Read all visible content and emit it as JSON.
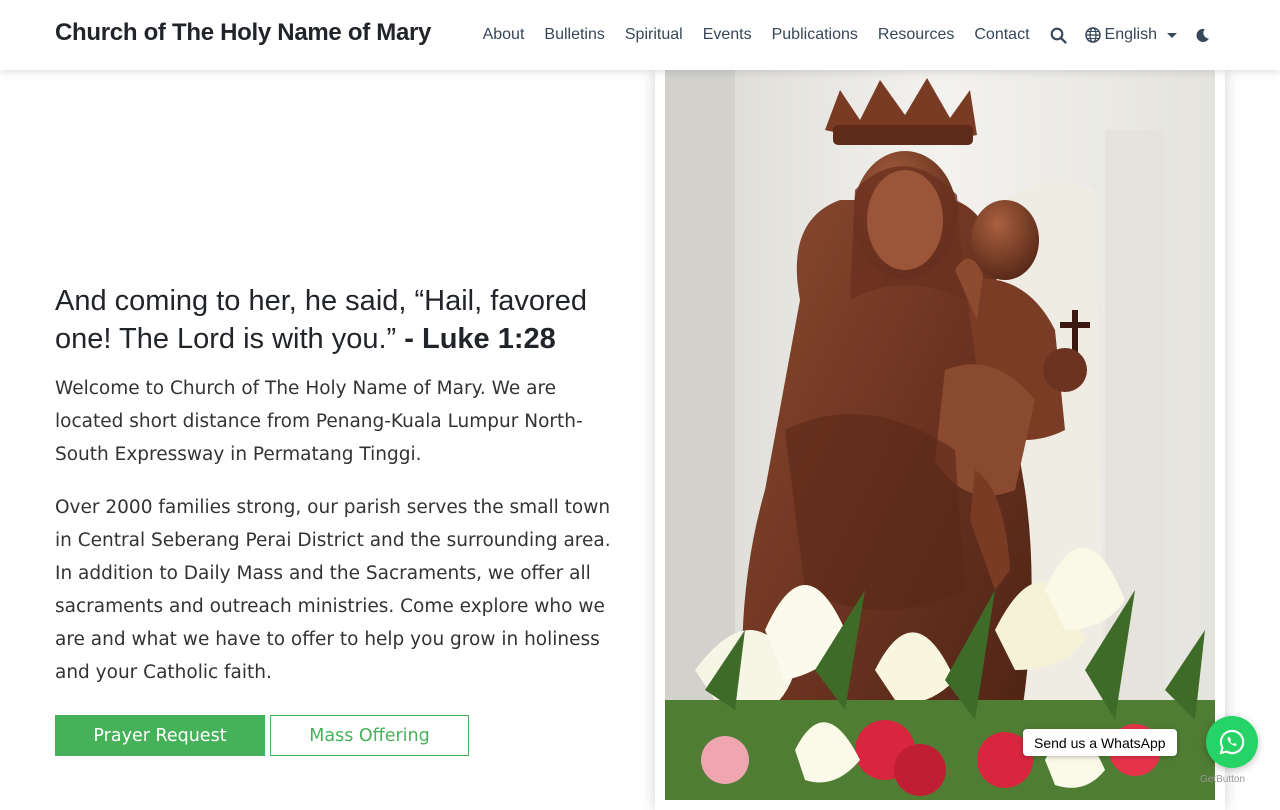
{
  "header": {
    "brand": "Church of The Holy Name of Mary",
    "nav": [
      "About",
      "Bulletins",
      "Spiritual",
      "Events",
      "Publications",
      "Resources",
      "Contact"
    ],
    "language": "English",
    "icons": {
      "search": "search-icon",
      "globe": "globe-icon",
      "theme": "moon-icon"
    }
  },
  "hero": {
    "quote": "And coming to her, he said, “Hail, favored one! The Lord is with you.”",
    "quote_ref": "- Luke 1:28",
    "intro_prefix": "Welcome to ",
    "intro_name": "Church of The Holy Name of Mary",
    "intro_suffix": ". We are located short distance from Penang-Kuala Lumpur North-South Expressway in Permatang Tinggi.",
    "about": "Over 2000 families strong, our parish serves the small town in Central Seberang Perai District and the surrounding area. In addition to Daily Mass and the Sacraments, we offer all sacraments and outreach ministries. Come explore who we are and what we have to offer to help you grow in holiness and your Catholic faith.",
    "buttons": {
      "primary": "Prayer Request",
      "secondary": "Mass Offering"
    }
  },
  "whatsapp": {
    "label": "Send us a WhatsApp",
    "credit": "GetButton"
  },
  "colors": {
    "accent": "#45b25a",
    "whatsapp": "#25d366",
    "nav_text": "#37475a"
  }
}
